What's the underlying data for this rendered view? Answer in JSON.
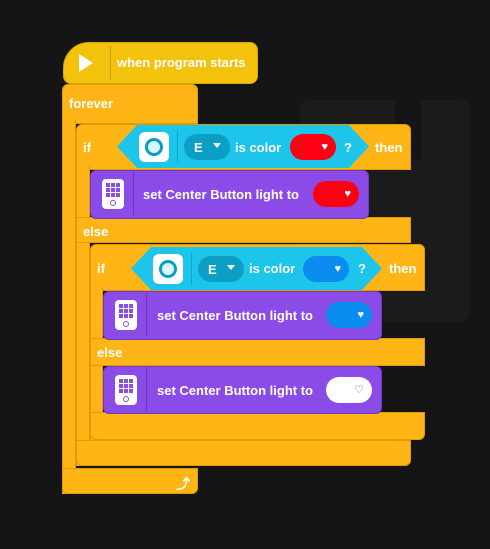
{
  "program": {
    "hat_label": "when program starts",
    "forever_label": "forever",
    "outer_if": {
      "if_label": "if",
      "port": "E",
      "condition_label": "is color",
      "question": "?",
      "then_label": "then",
      "color": "#ff0013",
      "action_label": "set Center Button light to",
      "action_color": "#ff0013"
    },
    "else_label": "else",
    "inner_if": {
      "if_label": "if",
      "port": "E",
      "condition_label": "is color",
      "question": "?",
      "then_label": "then",
      "color": "#0b8cf0",
      "action_label": "set Center Button light to",
      "action_color": "#0b8cf0"
    },
    "inner_else_label": "else",
    "inner_else_action_label": "set Center Button light to",
    "inner_else_action_color": "#ffffff"
  },
  "icons": {
    "play": "play-icon",
    "sensor": "color-sensor-icon",
    "light": "hub-light-icon",
    "loop": "loop-arrow-icon"
  }
}
